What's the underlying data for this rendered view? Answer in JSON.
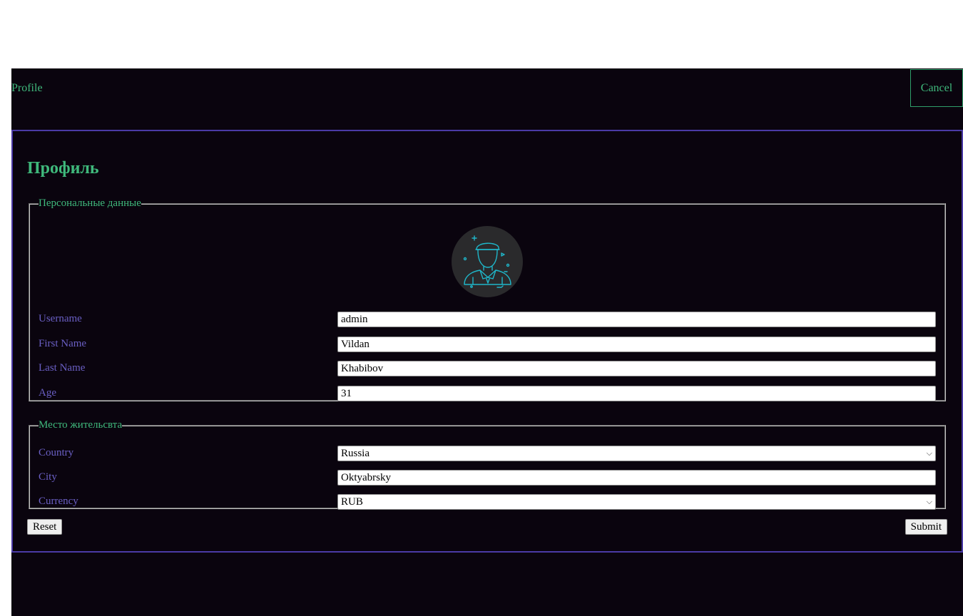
{
  "topbar": {
    "brand": "Profile",
    "cancel_label": "Cancel"
  },
  "page": {
    "title": "Профиль"
  },
  "personal": {
    "legend": "Персональные данные",
    "avatar_icon": "user-avatar-icon",
    "fields": [
      {
        "label": "Username",
        "value": "admin"
      },
      {
        "label": "First Name",
        "value": "Vildan"
      },
      {
        "label": "Last Name",
        "value": "Khabibov"
      },
      {
        "label": "Age",
        "value": "31"
      }
    ]
  },
  "residence": {
    "legend": "Место жительсвта",
    "country": {
      "label": "Country",
      "value": "Russia"
    },
    "city": {
      "label": "City",
      "value": "Oktyabrsky"
    },
    "currency": {
      "label": "Currency",
      "value": "RUB"
    }
  },
  "actions": {
    "reset_label": "Reset",
    "submit_label": "Submit"
  },
  "colors": {
    "background": "#0a040e",
    "accent_green": "#3fb97c",
    "label_purple": "#6a5fc4",
    "card_border": "#4b3aa6",
    "avatar_line": "#1fb6c9"
  }
}
